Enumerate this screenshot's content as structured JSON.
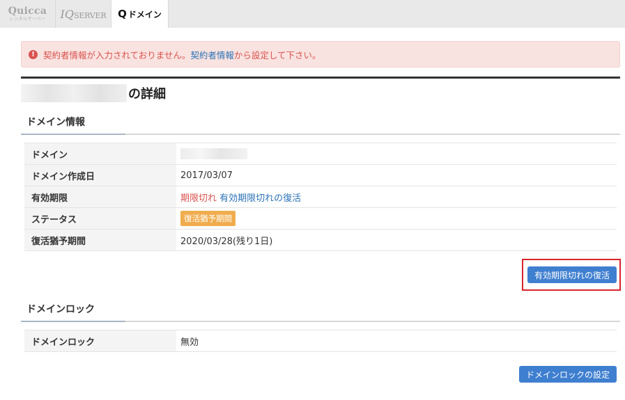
{
  "tabs": {
    "quicca": {
      "label": "Quicca",
      "sub": "レンタルサーバー"
    },
    "iqserver": {
      "label_iq": "IQ",
      "label_server": "SERVER"
    },
    "qdomain": {
      "label_q": "Q",
      "label": "ドメイン"
    }
  },
  "alert": {
    "icon": "exclamation-circle",
    "text_before": "契約者情報が入力されておりません。",
    "link": "契約者情報",
    "text_after": "から設定して下さい。"
  },
  "page": {
    "title_suffix": "の詳細"
  },
  "domain_info": {
    "heading": "ドメイン情報",
    "rows": {
      "domain": {
        "label": "ドメイン"
      },
      "created": {
        "label": "ドメイン作成日",
        "value": "2017/03/07"
      },
      "expiry": {
        "label": "有効期限",
        "status": "期限切れ",
        "link": "有効期限切れの復活"
      },
      "status": {
        "label": "ステータス",
        "badge": "復活猶予期間"
      },
      "grace": {
        "label": "復活猶予期間",
        "value": "2020/03/28(残り1日)"
      }
    },
    "restore_button": "有効期限切れの復活"
  },
  "domain_lock": {
    "heading": "ドメインロック",
    "row": {
      "label": "ドメインロック",
      "value": "無効"
    },
    "settings_button": "ドメインロックの設定"
  },
  "colors": {
    "alert_text": "#d9534f",
    "alert_bg": "#f9e3e0",
    "link": "#2b72b7",
    "badge": "#f0ad4e",
    "button": "#3f7fd0",
    "highlight": "#d9232b"
  }
}
